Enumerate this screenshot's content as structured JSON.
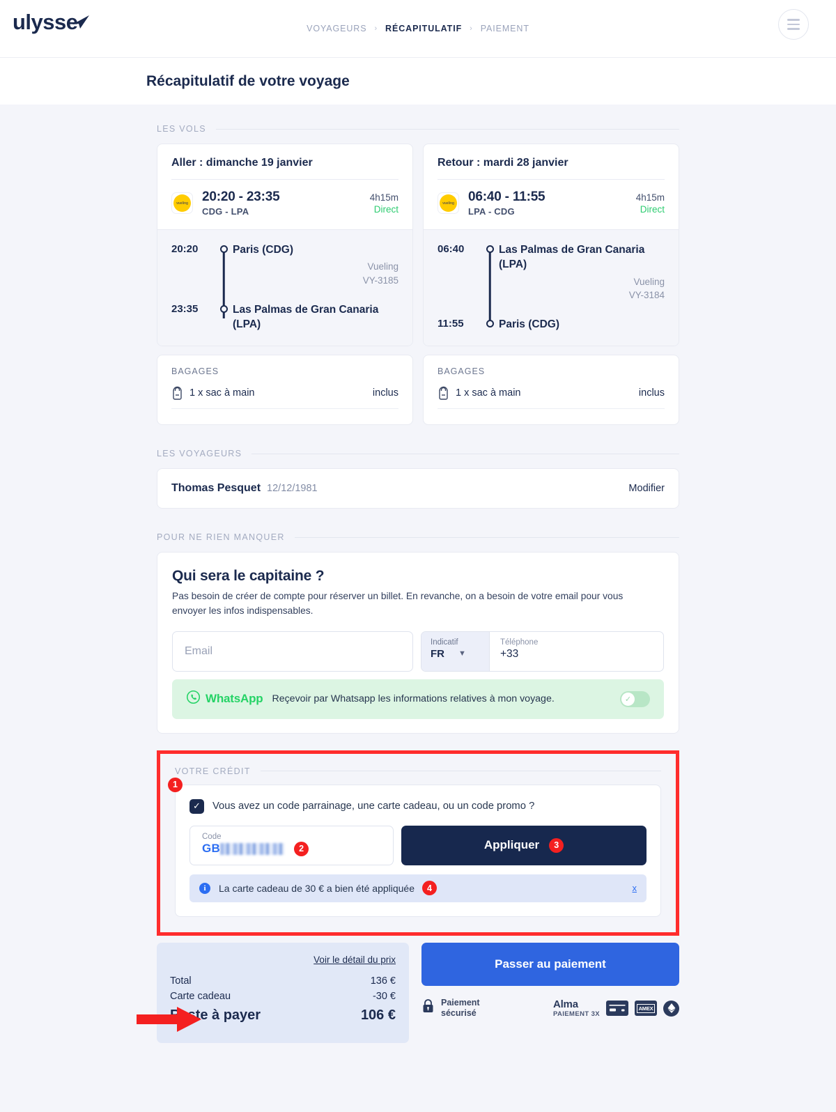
{
  "header": {
    "logo_text": "ulysse",
    "logo_icon": "paper-plane-icon",
    "breadcrumb": [
      {
        "label": "VOYAGEURS",
        "active": false
      },
      {
        "label": "RÉCAPITULATIF",
        "active": true
      },
      {
        "label": "PAIEMENT",
        "active": false
      }
    ],
    "separator": "›",
    "menu_icon": "hamburger-menu-icon"
  },
  "page_title": "Récapitulatif de votre voyage",
  "sections": {
    "flights_label": "LES VOLS",
    "travelers_label": "LES VOYAGEURS",
    "contact_label": "POUR NE RIEN MANQUER",
    "credit_label": "VOTRE CRÉDIT"
  },
  "flights": [
    {
      "heading": "Aller : dimanche 19 janvier",
      "airline_logo_text": "vueling",
      "times": "20:20 - 23:35",
      "route": "CDG - LPA",
      "duration": "4h15m",
      "stops": "Direct",
      "legs": [
        {
          "time": "20:20",
          "airport": "Paris (CDG)"
        },
        {
          "time": "23:35",
          "airport": "Las Palmas de Gran Canaria (LPA)"
        }
      ],
      "operator": "Vueling",
      "flight_number": "VY-3185",
      "baggage_label": "BAGAGES",
      "baggage_item": "1 x sac à main",
      "baggage_status": "inclus"
    },
    {
      "heading": "Retour : mardi 28 janvier",
      "airline_logo_text": "vueling",
      "times": "06:40 - 11:55",
      "route": "LPA - CDG",
      "duration": "4h15m",
      "stops": "Direct",
      "legs": [
        {
          "time": "06:40",
          "airport": "Las Palmas de Gran Canaria (LPA)"
        },
        {
          "time": "11:55",
          "airport": "Paris (CDG)"
        }
      ],
      "operator": "Vueling",
      "flight_number": "VY-3184",
      "baggage_label": "BAGAGES",
      "baggage_item": "1 x sac à main",
      "baggage_status": "inclus"
    }
  ],
  "traveler": {
    "name": "Thomas Pesquet",
    "birthdate": "12/12/1981",
    "edit_label": "Modifier"
  },
  "captain": {
    "title": "Qui sera le capitaine ?",
    "subtitle": "Pas besoin de créer de compte pour réserver un billet. En revanche, on a besoin de votre email pour vous envoyer les infos indispensables.",
    "email_placeholder": "Email",
    "indicatif_label": "Indicatif",
    "indicatif_value": "FR",
    "phone_label": "Téléphone",
    "phone_value": "+33",
    "whatsapp_brand": "WhatsApp",
    "whatsapp_text": "Reçevoir par Whatsapp les informations relatives à mon voyage.",
    "whatsapp_toggle_state": "on"
  },
  "credit": {
    "checkbox_checked": true,
    "checkbox_label": "Vous avez un code parrainage, une carte cadeau, ou un code promo ?",
    "code_field_label": "Code",
    "code_field_value": "GB",
    "code_field_masked": true,
    "apply_button": "Appliquer",
    "info_message": "La carte cadeau de 30 € a bien été appliquée",
    "info_close": "x",
    "badges": [
      "1",
      "2",
      "3",
      "4"
    ]
  },
  "price": {
    "detail_link": "Voir le détail du prix",
    "rows": [
      {
        "label": "Total",
        "value": "136 €"
      },
      {
        "label": "Carte cadeau",
        "value": "-30 €"
      }
    ],
    "total_label": "Reste à payer",
    "total_value": "106 €"
  },
  "payment": {
    "button": "Passer au paiement",
    "secure_line1": "Paiement",
    "secure_line2": "sécurisé",
    "lock_icon": "lock-icon",
    "alma_name": "Alma",
    "alma_sub": "PAIEMENT 3X",
    "card_icon": "credit-card-icon",
    "amex_icon": "amex-card-icon",
    "other_icon": "payment-method-icon"
  },
  "annotation": {
    "highlight_color": "#ff2d2d",
    "arrow_icon": "red-arrow-icon",
    "arrow_target": "Carte cadeau"
  },
  "colors": {
    "navy": "#1b2a4e",
    "blue": "#2f65e0",
    "green": "#2ecc71",
    "whatsapp_green": "#25D366",
    "bg": "#f4f5fa",
    "red": "#ff2d2d"
  }
}
